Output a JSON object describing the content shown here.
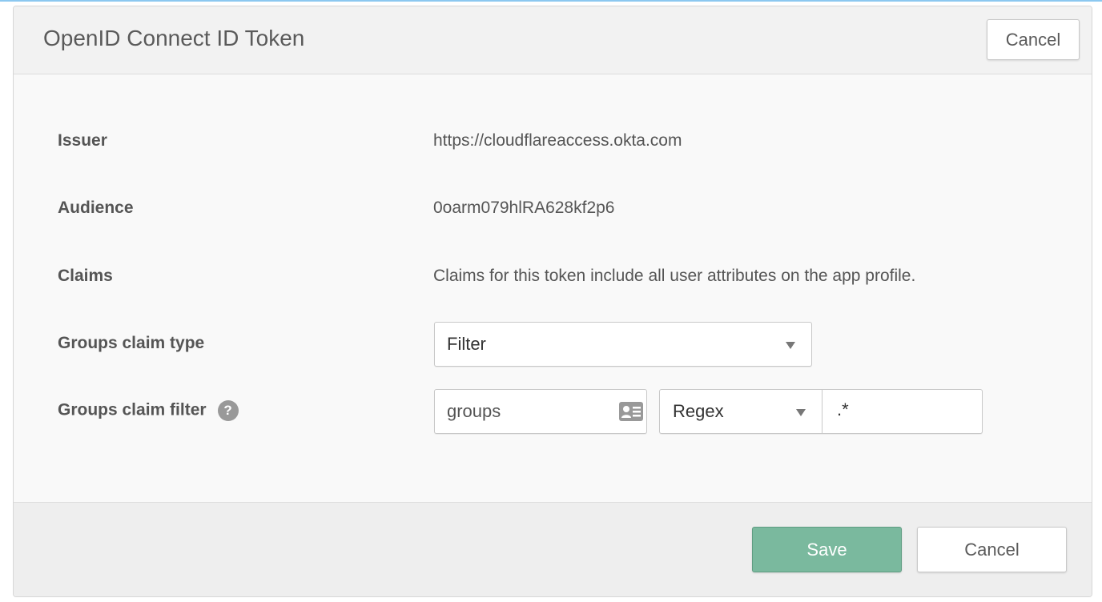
{
  "title": "OpenID Connect ID Token",
  "header_cancel": "Cancel",
  "fields": {
    "issuer": {
      "label": "Issuer",
      "value": "https://cloudflareaccess.okta.com"
    },
    "audience": {
      "label": "Audience",
      "value": "0oarm079hlRA628kf2p6"
    },
    "claims": {
      "label": "Claims",
      "value": "Claims for this token include all user attributes on the app profile."
    },
    "groups_claim_type": {
      "label": "Groups claim type",
      "selected": "Filter"
    },
    "groups_claim_filter": {
      "label": "Groups claim filter",
      "help": "?",
      "name_value": "groups",
      "match_type": "Regex",
      "pattern_value": ".*"
    }
  },
  "footer": {
    "save": "Save",
    "cancel": "Cancel"
  },
  "colors": {
    "save_button": "#7ab99e",
    "top_line": "#8cc8f0"
  }
}
